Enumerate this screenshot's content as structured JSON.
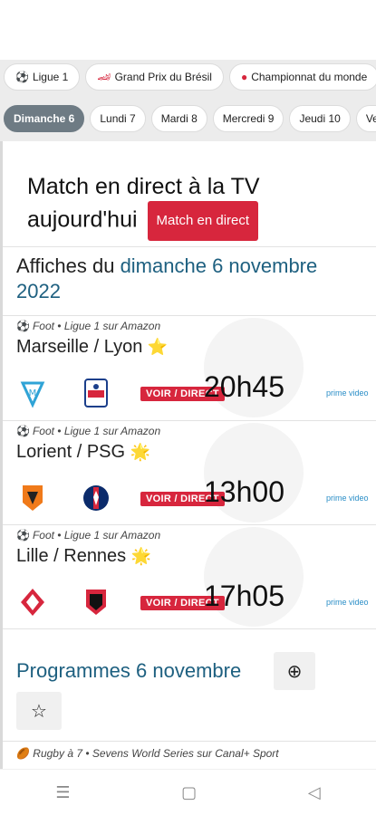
{
  "competitions": [
    {
      "icon": "soccer-ball-icon",
      "label": "Ligue 1"
    },
    {
      "icon": "race-car-icon",
      "label": "Grand Prix du Brésil"
    },
    {
      "icon": "boxing-glove-icon",
      "label": "Championnat du monde"
    }
  ],
  "days": [
    "Dimanche 6",
    "Lundi 7",
    "Mardi 8",
    "Mercredi 9",
    "Jeudi 10",
    "Vendr"
  ],
  "hero": {
    "title": "Match en direct à la TV aujourd'hui",
    "button": "Match en direct"
  },
  "affiches": {
    "prefix": "Affiches du ",
    "date": "dimanche 6 novembre 2022"
  },
  "matches": [
    {
      "meta": "Foot • Ligue 1 sur Amazon",
      "teams": "Marseille / Lyon",
      "star": "⭐",
      "voir": "VOIR / DIRECT",
      "time": "20h45",
      "channel": "prime video"
    },
    {
      "meta": "Foot • Ligue 1 sur Amazon",
      "teams": "Lorient / PSG",
      "star": "🌟",
      "voir": "VOIR / DIRECT",
      "time": "13h00",
      "channel": "prime video"
    },
    {
      "meta": "Foot • Ligue 1 sur Amazon",
      "teams": "Lille / Rennes",
      "star": "🌟",
      "voir": "VOIR / DIRECT",
      "time": "17h05",
      "channel": "prime video"
    }
  ],
  "programmes": {
    "title": "Programmes 6 novembre",
    "plus": "⊕",
    "star": "☆"
  },
  "rugby": "Rugby à 7 • Sevens World Series sur Canal+ Sport",
  "nav": {
    "menu": "☰",
    "home": "▢",
    "back": "◁"
  }
}
